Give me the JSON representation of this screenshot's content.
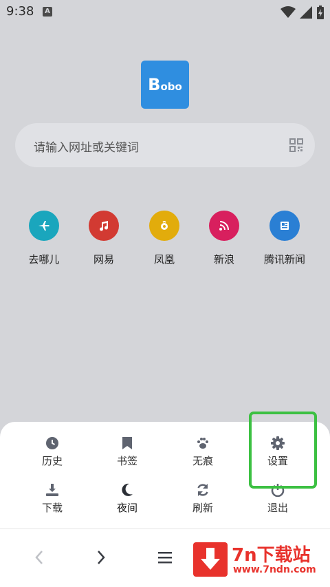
{
  "status_bar": {
    "time": "9:38",
    "notification_letter": "A"
  },
  "logo": {
    "text_big": "B",
    "text_small": "obo"
  },
  "search": {
    "placeholder": "请输入网址或关键词",
    "scan_icon": "qr-scan-icon"
  },
  "shortcuts": [
    {
      "label": "去哪儿",
      "icon": "plane-icon",
      "color": "#1aa6bd"
    },
    {
      "label": "网易",
      "icon": "music-note-icon",
      "color": "#d23a32"
    },
    {
      "label": "凤凰",
      "icon": "phoenix-icon",
      "color": "#e2ac0c"
    },
    {
      "label": "新浪",
      "icon": "rss-icon",
      "color": "#d81f5e"
    },
    {
      "label": "腾讯新闻",
      "icon": "newspaper-icon",
      "color": "#2a7fd4"
    }
  ],
  "menu": {
    "row1": [
      {
        "label": "历史",
        "icon": "clock-icon"
      },
      {
        "label": "书签",
        "icon": "bookmark-icon"
      },
      {
        "label": "无痕",
        "icon": "paw-icon"
      },
      {
        "label": "设置",
        "icon": "gear-icon"
      }
    ],
    "row2": [
      {
        "label": "下载",
        "icon": "download-icon"
      },
      {
        "label": "夜间",
        "icon": "moon-icon"
      },
      {
        "label": "刷新",
        "icon": "refresh-icon"
      },
      {
        "label": "退出",
        "icon": "power-icon"
      }
    ]
  },
  "bottom_nav": {
    "back_icon": "chevron-left-icon",
    "forward_icon": "chevron-right-icon",
    "menu_icon": "hamburger-icon"
  },
  "watermark": {
    "title": "7n下载站",
    "url": "www.7ndn.com"
  },
  "colors": {
    "highlight": "#3cc042",
    "accent": "#2f8ee0",
    "icon_gray": "#5f6470"
  }
}
